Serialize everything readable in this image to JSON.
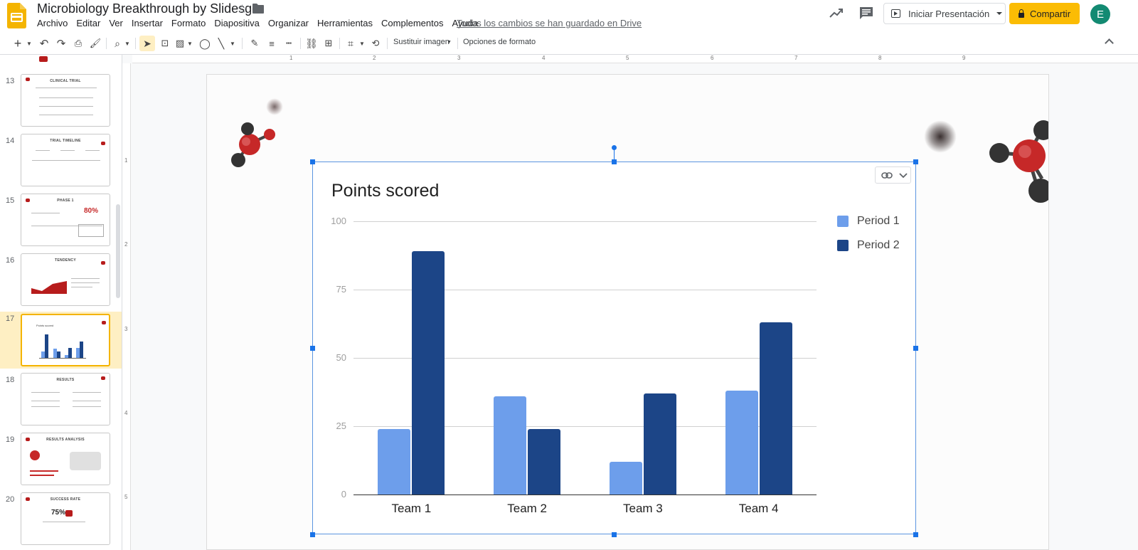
{
  "header": {
    "doc_title": "Microbiology Breakthrough by Slidesgo",
    "menu": [
      "Archivo",
      "Editar",
      "Ver",
      "Insertar",
      "Formato",
      "Diapositiva",
      "Organizar",
      "Herramientas",
      "Complementos",
      "Ayuda"
    ],
    "saved_message": "Todos los cambios se han guardado en Drive",
    "present_label": "Iniciar Presentación",
    "share_label": "Compartir",
    "avatar_letter": "E"
  },
  "toolbar": {
    "replace_image_label": "Sustituir imagen",
    "format_options_label": "Opciones de formato"
  },
  "ruler": {
    "h_numbers": [
      "1",
      "2",
      "3",
      "4",
      "5",
      "6",
      "7",
      "8",
      "9"
    ],
    "v_numbers": [
      "1",
      "2",
      "3",
      "4",
      "5"
    ]
  },
  "filmstrip": {
    "slides": [
      {
        "num": "13",
        "title": "CLINICAL TRIAL"
      },
      {
        "num": "14",
        "title": "TRIAL TIMELINE"
      },
      {
        "num": "15",
        "title": "PHASE 1",
        "big_text": "80%"
      },
      {
        "num": "16",
        "title": "TENDENCY"
      },
      {
        "num": "17",
        "title": "Points scored",
        "selected": true
      },
      {
        "num": "18",
        "title": "RESULTS"
      },
      {
        "num": "19",
        "title": "RESULTS ANALYSIS"
      },
      {
        "num": "20",
        "title": "SUCCESS RATE",
        "big_text": "75%"
      }
    ]
  },
  "colors": {
    "series1": "#6d9eeb",
    "series2": "#1c4587",
    "accent_share": "#fbbc04",
    "selection": "#1a73e8"
  },
  "chart_data": {
    "type": "bar",
    "title": "Points scored",
    "categories": [
      "Team 1",
      "Team 2",
      "Team 3",
      "Team 4"
    ],
    "series": [
      {
        "name": "Period 1",
        "values": [
          24,
          36,
          12,
          38
        ]
      },
      {
        "name": "Period 2",
        "values": [
          89,
          24,
          37,
          63
        ]
      }
    ],
    "yticks": [
      "0",
      "25",
      "50",
      "75",
      "100"
    ],
    "ylim": [
      0,
      100
    ],
    "legend_position": "right",
    "grid": true
  }
}
